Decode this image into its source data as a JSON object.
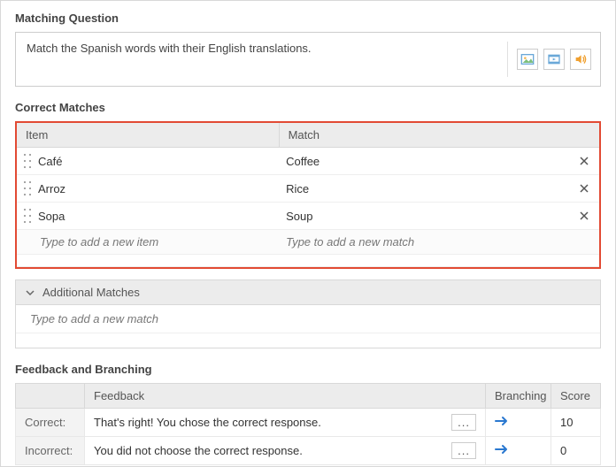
{
  "section_titles": {
    "question": "Matching Question",
    "matches": "Correct Matches",
    "additional": "Additional Matches",
    "feedback": "Feedback and Branching"
  },
  "question": {
    "text": "Match the Spanish words with their English translations."
  },
  "matches_table": {
    "headers": {
      "item": "Item",
      "match": "Match"
    },
    "rows": [
      {
        "item": "Café",
        "match": "Coffee"
      },
      {
        "item": "Arroz",
        "match": "Rice"
      },
      {
        "item": "Sopa",
        "match": "Soup"
      }
    ],
    "placeholders": {
      "item": "Type to add a new item",
      "match": "Type to add a new match"
    }
  },
  "additional": {
    "placeholder": "Type to add a new match"
  },
  "feedback_table": {
    "headers": {
      "blank": "",
      "feedback": "Feedback",
      "branching": "Branching",
      "score": "Score"
    },
    "rows": [
      {
        "label": "Correct:",
        "text": "That's right! You chose the correct response.",
        "score": "10"
      },
      {
        "label": "Incorrect:",
        "text": "You did not choose the correct response.",
        "score": "0"
      }
    ],
    "more_label": "..."
  }
}
